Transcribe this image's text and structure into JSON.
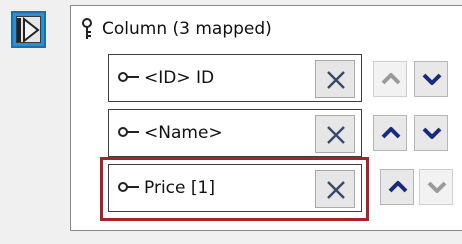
{
  "column_group": {
    "label": "Column (3 mapped)"
  },
  "rows": [
    {
      "label": "<ID> ID",
      "move_up_enabled": false,
      "move_down_enabled": true
    },
    {
      "label": "<Name>",
      "move_up_enabled": true,
      "move_down_enabled": true
    },
    {
      "label": "Price [1]",
      "move_up_enabled": true,
      "move_down_enabled": false,
      "highlighted": true
    }
  ],
  "colors": {
    "toggle_accent": "#2b8fd6",
    "highlight": "#a3242b",
    "arrow_enabled": "#1a2a7a",
    "arrow_disabled": "#9a9a9a"
  },
  "icons": {
    "toggle": "expand-toggle-icon",
    "column": "pin-icon",
    "row_key": "key-icon",
    "remove": "close-icon",
    "up": "chevron-up-icon",
    "down": "chevron-down-icon"
  }
}
